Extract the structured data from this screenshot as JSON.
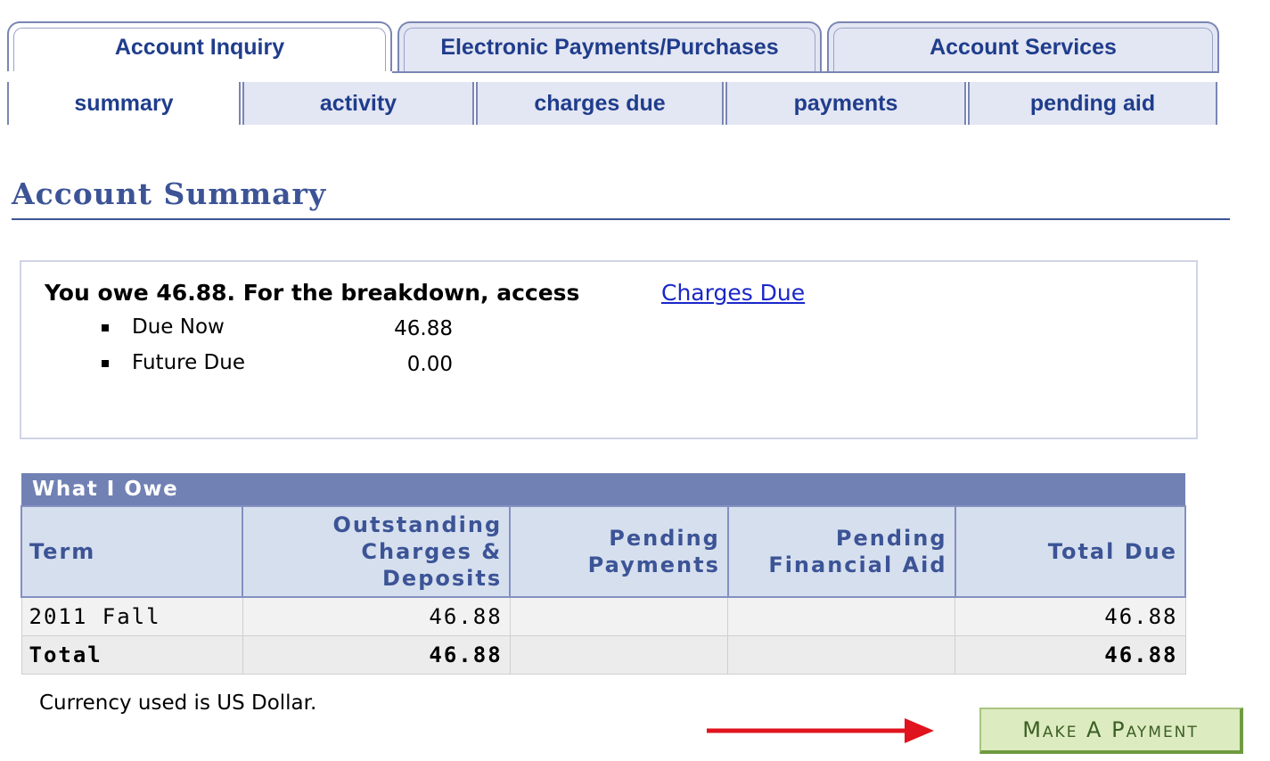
{
  "top_tabs": [
    {
      "label": "Account Inquiry",
      "active": true
    },
    {
      "label": "Electronic Payments/Purchases",
      "active": false
    },
    {
      "label": "Account Services",
      "active": false
    }
  ],
  "sub_tabs": [
    {
      "label": "summary",
      "active": true
    },
    {
      "label": "activity",
      "active": false
    },
    {
      "label": "charges due",
      "active": false
    },
    {
      "label": "payments",
      "active": false
    },
    {
      "label": "pending aid",
      "active": false
    }
  ],
  "page_title": "Account Summary",
  "summary": {
    "owe_text": "You owe 46.88.  For the breakdown, access",
    "link_text": "Charges Due",
    "items": [
      {
        "label": "Due Now",
        "value": "46.88"
      },
      {
        "label": "Future Due",
        "value": "0.00"
      }
    ]
  },
  "table": {
    "caption": "What I Owe",
    "headers": {
      "term": "Term",
      "outstanding": [
        "Outstanding",
        "Charges &",
        "Deposits"
      ],
      "pending_payments": [
        "Pending",
        "Payments"
      ],
      "pending_aid": [
        "Pending",
        "Financial Aid"
      ],
      "total_due": "Total Due"
    },
    "rows": [
      {
        "term": "2011 Fall",
        "outstanding": "46.88",
        "pending_payments": "",
        "pending_aid": "",
        "total_due": "46.88"
      }
    ],
    "total": {
      "term": "Total",
      "outstanding": "46.88",
      "pending_payments": "",
      "pending_aid": "",
      "total_due": "46.88"
    }
  },
  "currency_note": "Currency used is US Dollar.",
  "make_payment_label": "Make A Payment",
  "colors": {
    "arrow": "#e0141e",
    "tab_text": "#1f3d8c",
    "title": "#3c5496",
    "table_caption": "#7181b4"
  }
}
